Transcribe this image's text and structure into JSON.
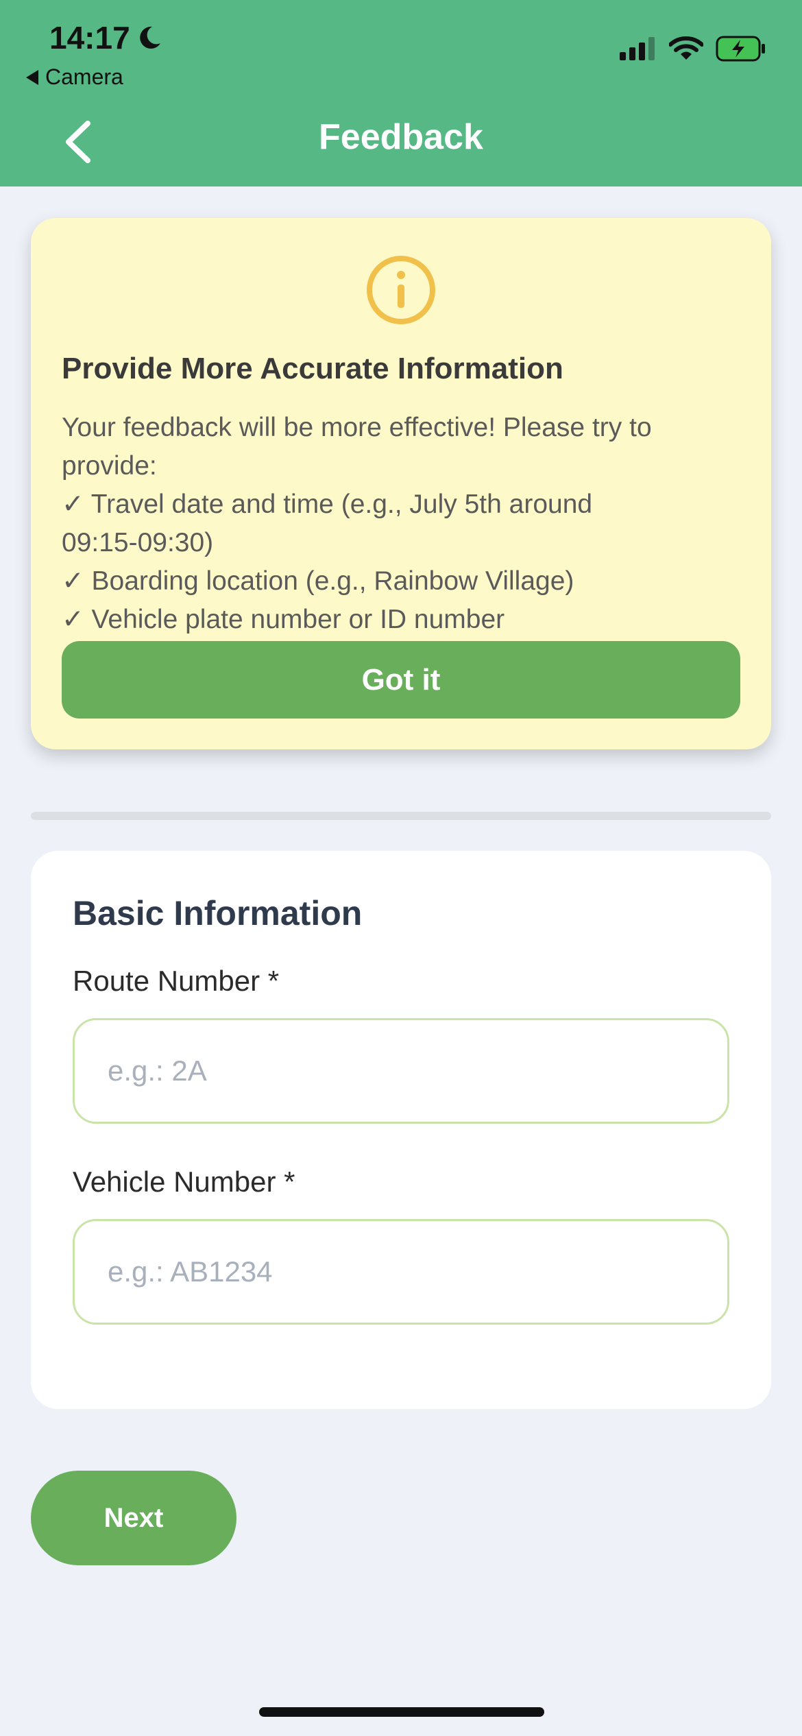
{
  "status_bar": {
    "time": "14:17",
    "back_app": "Camera"
  },
  "nav": {
    "title": "Feedback"
  },
  "tip": {
    "title": "Provide More Accurate Information",
    "lines": [
      "Your feedback will be more effective! Please try to",
      "provide:",
      "✓ Travel date and time (e.g., July 5th around",
      "09:15-09:30)",
      "✓ Boarding location (e.g., Rainbow Village)",
      "✓ Vehicle plate number or ID number"
    ],
    "button_label": "Got it"
  },
  "form": {
    "section_title": "Basic Information",
    "route_label": "Route Number *",
    "route_placeholder": "e.g.: 2A",
    "vehicle_label": "Vehicle Number *",
    "vehicle_placeholder": "e.g.: AB1234"
  },
  "next_label": "Next",
  "colors": {
    "header": "#55b885",
    "accent_button": "#68ae5b",
    "tip_background": "#fef9c8",
    "info_icon": "#f0c04a",
    "input_border": "#c9e3a8"
  }
}
